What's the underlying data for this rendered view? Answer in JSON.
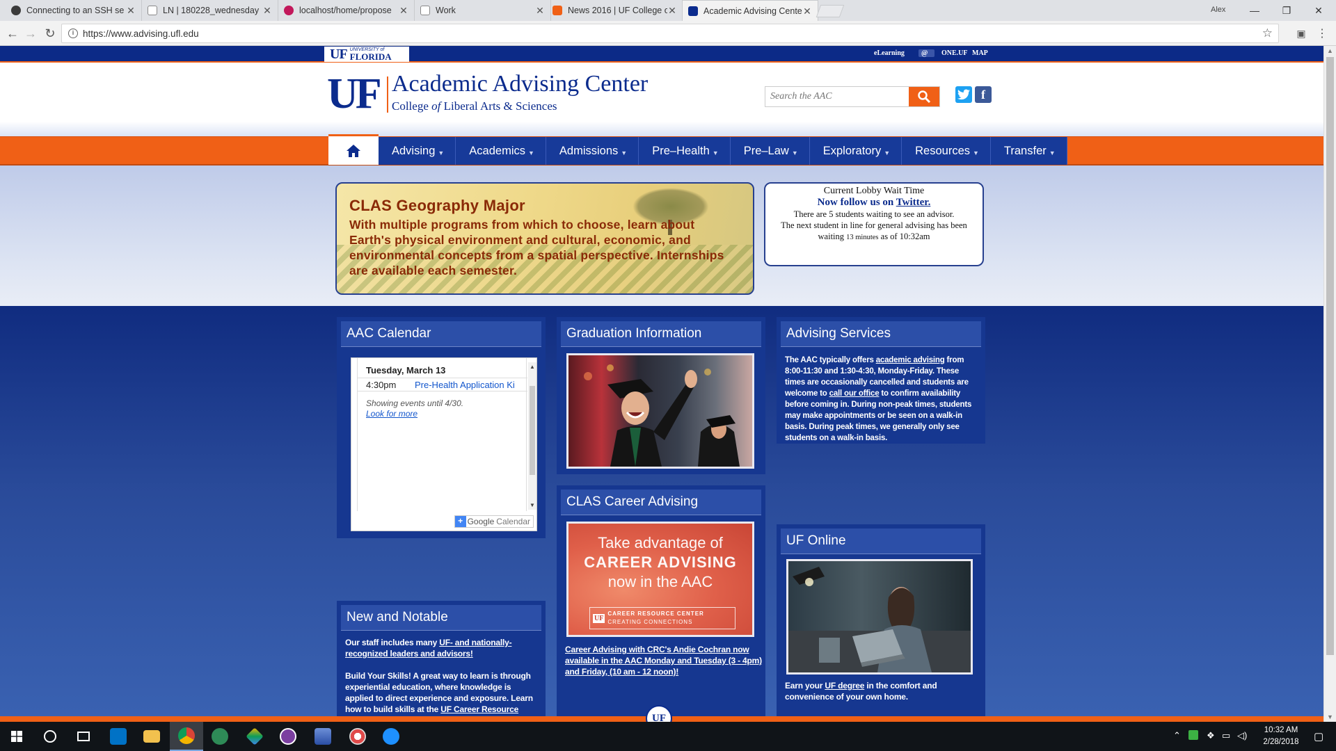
{
  "browser": {
    "tabs": [
      {
        "title": "Connecting to an SSH se",
        "color": "#3b3b3b"
      },
      {
        "title": "LN | 180228_wednesday",
        "color": "#ffffff"
      },
      {
        "title": "localhost/home/propose",
        "color": "#c2185b"
      },
      {
        "title": "Work",
        "color": "#ffffff"
      },
      {
        "title": "News 2016 | UF College o",
        "color": "#f06016"
      },
      {
        "title": "Academic Advising Cente",
        "color": "#0b2b8d"
      }
    ],
    "user": "Alex",
    "url": "https://www.advising.ufl.edu",
    "window_controls": {
      "minimize": "—",
      "maximize": "❐",
      "close": "✕"
    }
  },
  "site": {
    "utility": {
      "logo_uf": "UF",
      "logo_university_of": "UNIVERSITY of",
      "logo_florida": "FLORIDA",
      "links": [
        "eLearning",
        "@",
        "ONE.UF",
        "MAP"
      ]
    },
    "header": {
      "logo": "UF",
      "title": "Academic Advising Center",
      "subtitle_pre": "College ",
      "subtitle_of": "of",
      "subtitle_post": " Liberal Arts & Sciences",
      "search_placeholder": "Search the AAC"
    },
    "nav": {
      "items": [
        "Advising",
        "Academics",
        "Admissions",
        "Pre–Health",
        "Pre–Law",
        "Exploratory",
        "Resources",
        "Transfer"
      ]
    },
    "feature": {
      "title": "CLAS Geography Major",
      "text": "With multiple programs from which to choose, learn about Earth's physical environment and cultural, economic, and environmental concepts from a spatial perspective. Internships are available each semester."
    },
    "lobby": {
      "title": "Current Lobby Wait Time",
      "follow_pre": "Now follow us on ",
      "follow_link": "Twitter.",
      "line1": "There are 5 students waiting to see an advisor.",
      "line2": "The next student in line for general advising has been waiting",
      "minutes": "13 minutes",
      "as_of": "as of 10:32am"
    },
    "calendar": {
      "title": "AAC Calendar",
      "day": "Tuesday, March 13",
      "event_time": "4:30pm",
      "event_name": "Pre-Health Application Ki",
      "note": "Showing events until 4/30.",
      "more": "Look for more",
      "brand_google": "Google",
      "brand_calendar": "Calendar"
    },
    "graduation": {
      "title": "Graduation Information"
    },
    "services": {
      "title": "Advising Services",
      "t1": "The AAC typically offers ",
      "link1": "academic advising",
      "t2": " from 8:00-11:30 and 1:30-4:30, Monday-Friday. These times are occasionally cancelled and students are welcome to ",
      "link2": "call our office",
      "t3": " to confirm availability before coming in. During non-peak times, students may make appointments or be seen on a walk-in basis.  During peak times, we generally only see students on a walk-in basis."
    },
    "notable": {
      "title": "New and Notable",
      "p1_pre": "Our staff includes many ",
      "p1_link": "UF- and nationally-recognized leaders and advisors!",
      "p2_bold": "Build Your Skills!",
      "p2_text": " A great way to learn is through experiential education, where knowledge is applied to direct experience and exposure. Learn how to build skills at the ",
      "p2_link": "UF Career Resource Center",
      "p2_end": "."
    },
    "career": {
      "title": "CLAS Career Advising",
      "banner_line1": "Take advantage of",
      "banner_line2": "CAREER ADVISING",
      "banner_line3": "now in the AAC",
      "banner_badge": "UF",
      "banner_crc": "CAREER RESOURCE CENTER",
      "banner_tag": "CREATING CONNECTIONS",
      "caption": "Career Advising with CRC's Andie Cochran now available in the AAC Monday and Tuesday (3 - 4pm) and Friday, (10 am - 12 noon)!"
    },
    "online": {
      "title": "UF Online",
      "pre": "Earn your ",
      "link": "UF degree",
      "post": " in the comfort and convenience of your own home."
    },
    "footer_logo": "UF"
  },
  "taskbar": {
    "time": "10:32 AM",
    "date": "2/28/2018"
  },
  "colors": {
    "uf_blue": "#0b2b8d",
    "uf_orange": "#f06016",
    "nav_blue": "#173a99"
  }
}
